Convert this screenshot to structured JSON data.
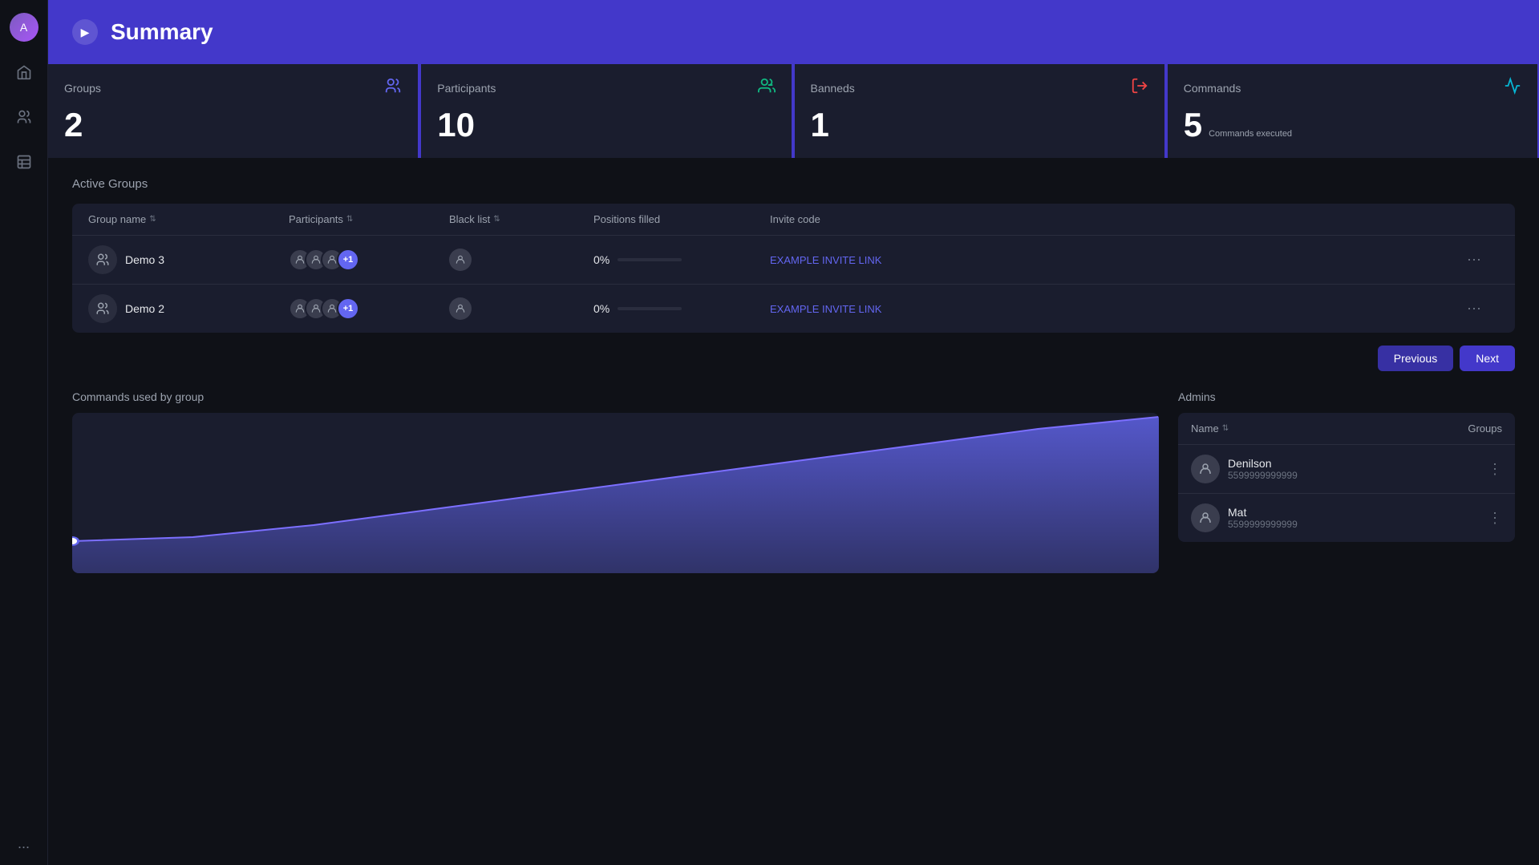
{
  "sidebar": {
    "avatar_initial": "A",
    "nav_items": [
      {
        "name": "home",
        "icon": "home"
      },
      {
        "name": "groups",
        "icon": "users"
      },
      {
        "name": "list",
        "icon": "list"
      }
    ],
    "more_label": "..."
  },
  "header": {
    "title": "Summary",
    "toggle_icon": "▶"
  },
  "stats": [
    {
      "id": "groups",
      "label": "Groups",
      "value": "2",
      "sub": "",
      "icon": "groups"
    },
    {
      "id": "participants",
      "label": "Participants",
      "value": "10",
      "sub": "",
      "icon": "participants"
    },
    {
      "id": "banneds",
      "label": "Banneds",
      "value": "1",
      "sub": "",
      "icon": "banneds"
    },
    {
      "id": "commands",
      "label": "Commands",
      "value": "5",
      "sub": "Commands executed",
      "icon": "commands"
    }
  ],
  "active_groups": {
    "section_title": "Active Groups",
    "columns": [
      "Group name",
      "Participants",
      "Black list",
      "Positions filled",
      "Invite code"
    ],
    "rows": [
      {
        "name": "Demo 3",
        "participants_count": "+1",
        "blacklist_count": 1,
        "positions_pct": "0%",
        "positions_val": 0,
        "invite_link": "EXAMPLE INVITE LINK"
      },
      {
        "name": "Demo 2",
        "participants_count": "+1",
        "blacklist_count": 1,
        "positions_pct": "0%",
        "positions_val": 0,
        "invite_link": "EXAMPLE INVITE LINK"
      }
    ]
  },
  "pagination": {
    "prev_label": "Previous",
    "next_label": "Next"
  },
  "commands_chart": {
    "section_title": "Commands used by group"
  },
  "admins": {
    "section_title": "Admins",
    "columns": [
      "Name",
      "Groups"
    ],
    "rows": [
      {
        "name": "Denilson",
        "phone": "5599999999999"
      },
      {
        "name": "Mat",
        "phone": "5599999999999"
      }
    ]
  }
}
